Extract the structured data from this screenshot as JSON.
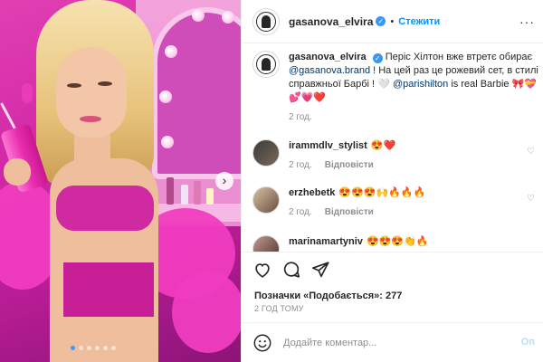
{
  "post": {
    "author": "gasanova_elvira",
    "follow_label": "Стежити",
    "separator": "•",
    "more_label": "···",
    "verified_mark": "✓"
  },
  "caption": {
    "username": "gasanova_elvira",
    "text_part1": "Періс Хілтон вже втретє обирає",
    "mention1": "@gasanova.brand",
    "text_part2": "! На цей раз це рожевий сет, в стилі справжньої Барбі ! 🤍",
    "mention2": "@parishilton",
    "text_part3": "is real Barbie 🎀💝💕💗❤️",
    "time": "2 год."
  },
  "comments": [
    {
      "username": "irammdlv_stylist",
      "text": "😍❤️",
      "time": "2 год.",
      "reply": "Відповісти"
    },
    {
      "username": "erzhebetk",
      "text": "😍😍😍🙌🔥🔥🔥",
      "time": "2 год.",
      "reply": "Відповісти"
    },
    {
      "username": "marinamartyniv",
      "text": "😍😍😍👏🔥",
      "time": "",
      "reply": ""
    }
  ],
  "footer": {
    "likes": "Позначки «Подобається»: 277",
    "time_ago": "2 ГОД ТОМУ",
    "comment_placeholder": "Додайте коментар...",
    "post_label": "Оп"
  },
  "carousel": {
    "dots": 6,
    "active": 1,
    "next_glyph": "›"
  },
  "icons": [
    "heart-icon",
    "comment-icon",
    "share-icon",
    "emoji-icon",
    "more-icon",
    "verified-icon",
    "chevron-right-icon"
  ],
  "colors": {
    "accent": "#0095f6",
    "link": "#00376b",
    "verified": "#3897f0",
    "muted": "#8e8e8e",
    "photo_pink": "#d22aa8"
  }
}
